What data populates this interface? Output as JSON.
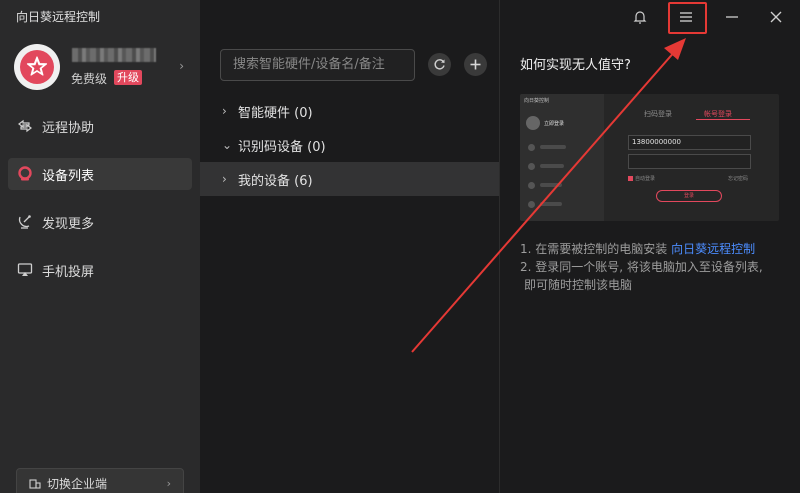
{
  "app": {
    "title": "向日葵远程控制"
  },
  "profile": {
    "tier": "免费级",
    "upgrade_label": "升级"
  },
  "nav": {
    "items": [
      {
        "label": "远程协助",
        "icon": "remote-assist-icon"
      },
      {
        "label": "设备列表",
        "icon": "device-list-icon"
      },
      {
        "label": "发现更多",
        "icon": "discover-icon"
      },
      {
        "label": "手机投屏",
        "icon": "screen-mirror-icon"
      }
    ],
    "active_index": 1
  },
  "enterprise": {
    "label": "切换企业端"
  },
  "devices": {
    "search_placeholder": "搜索智能硬件/设备名/备注",
    "groups": [
      {
        "label": "智能硬件 (0)",
        "expanded": false
      },
      {
        "label": "识别码设备 (0)",
        "expanded": true
      },
      {
        "label": "我的设备 (6)",
        "expanded": false,
        "selected": true
      }
    ]
  },
  "help": {
    "title": "如何实现无人值守?",
    "preview": {
      "window_title": "向日葵控制",
      "side_label": "立即登录",
      "tab_scan": "扫码登录",
      "tab_account": "帐号登录",
      "phone_value": "13800000000",
      "remember": "自动登录",
      "forgot": "忘记密码",
      "login_button": "登录"
    },
    "step1_text": "1. 在需要被控制的电脑安装 ",
    "step1_link": "向日葵远程控制",
    "step2_line1": "2. 登录同一个账号, 将该电脑加入至设备列表,",
    "step2_line2": "即可随时控制该电脑"
  },
  "colors": {
    "accent": "#e2485d",
    "annotation": "#e53935",
    "link": "#4c8dff"
  }
}
